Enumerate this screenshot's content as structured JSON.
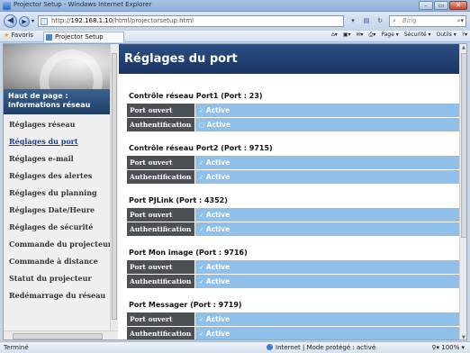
{
  "window": {
    "title": "Projector Setup - Windows Internet Explorer",
    "buttons": {
      "minimize": "–",
      "maximize": "▭",
      "close": "✕"
    }
  },
  "address_bar": {
    "url_prefix": "http://",
    "url_host": "192.168.1.10",
    "url_path": "/html/projectorsetup.html",
    "search_placeholder": "Bing"
  },
  "favorites_bar": {
    "favorites_label": "Favoris",
    "tab_label": "Projector Setup",
    "commands": [
      "Page ▾",
      "Sécurité ▾",
      "Outils ▾"
    ]
  },
  "sidebar": {
    "home_label_1": "Haut de page :",
    "home_label_2": "Informations réseau",
    "items": [
      {
        "label": "Réglages réseau",
        "active": false
      },
      {
        "label": "Réglages du port",
        "active": true
      },
      {
        "label": "Réglages e-mail",
        "active": false
      },
      {
        "label": "Réglages des alertes",
        "active": false
      },
      {
        "label": "Réglages du planning",
        "active": false
      },
      {
        "label": "Réglages Date/Heure",
        "active": false
      },
      {
        "label": "Réglages de sécurité",
        "active": false
      },
      {
        "label": "Commande du projecteur",
        "active": false
      },
      {
        "label": "Commande à distance",
        "active": false
      },
      {
        "label": "Statut du projecteur",
        "active": false
      },
      {
        "label": "Redémarrage du réseau",
        "active": false
      }
    ]
  },
  "main": {
    "page_title": "Réglages du port",
    "sections": [
      {
        "title": "Contrôle réseau Port1 (Port : 23)",
        "rows": [
          {
            "label": "Port ouvert",
            "value": "Active",
            "checked": true
          },
          {
            "label": "Authentification",
            "value": "Active",
            "checked": false
          }
        ]
      },
      {
        "title": "Contrôle réseau Port2 (Port : 9715)",
        "rows": [
          {
            "label": "Port ouvert",
            "value": "Active",
            "checked": true
          },
          {
            "label": "Authentification",
            "value": "Active",
            "checked": true
          }
        ]
      },
      {
        "title": "Port PJLink (Port : 4352)",
        "rows": [
          {
            "label": "Port ouvert",
            "value": "Active",
            "checked": true
          },
          {
            "label": "Authentification",
            "value": "Active",
            "checked": true
          }
        ]
      },
      {
        "title": "Port Mon image (Port : 9716)",
        "rows": [
          {
            "label": "Port ouvert",
            "value": "Active",
            "checked": true
          },
          {
            "label": "Authentification",
            "value": "Active",
            "checked": true
          }
        ]
      },
      {
        "title": "Port Messager (Port : 9719)",
        "rows": [
          {
            "label": "Port ouvert",
            "value": "Active",
            "checked": true
          },
          {
            "label": "Authentification",
            "value": "Active",
            "checked": true
          }
        ]
      }
    ]
  },
  "status_bar": {
    "left_text": "Terminé",
    "zone_text": "Internet | Mode protégé : activé",
    "zoom": "100%"
  }
}
